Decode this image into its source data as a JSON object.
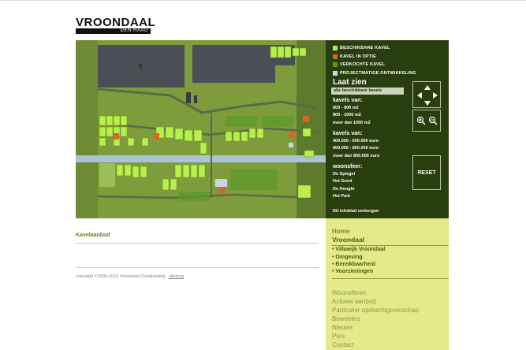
{
  "logo": {
    "main": "VROONDAAL",
    "sub": "DEN HAAG"
  },
  "legend": [
    {
      "label": "BESCHIKBARE KAVEL",
      "color": "#b8f04a"
    },
    {
      "label": "KAVEL IN OPTIE",
      "color": "#d2691e"
    },
    {
      "label": "VERKOCHTE KAVEL",
      "color": "#5a9a2a"
    },
    {
      "label": "PROJECTMATIGE ONTWIKKELING",
      "color": "#c8d6e8"
    }
  ],
  "filters": {
    "title": "Laat zien",
    "all_label": "alle beschikbare kavels",
    "kavels_van_head": "kavels van:",
    "kavels_van": [
      "600 - 800 m2",
      "800 - 1000 m2",
      "meer dan 1000 m2"
    ],
    "prijs_head": "kavels van:",
    "prijs": [
      "400.000 - 600.000 euro",
      "600.000 - 800.000 euro",
      "meer dan 800.000 euro"
    ],
    "woonsfeer_head": "woonsfeer:",
    "woonsfeer": [
      "De Spiegel",
      "Het Goed",
      "De Hoogte",
      "Het Park"
    ],
    "reset_label": "RESET",
    "infoblad": "Dit infoblad verbergen"
  },
  "content": {
    "title": "Kavelaanbod",
    "copyright": "copyright ©2009-2010 Vroondaal Ontwikkeling - ",
    "sitemap": "sitemap"
  },
  "sidenav": {
    "home": "Home",
    "current": "Vroondaal",
    "sub": [
      "• Villawijk Vroondaal",
      "• Omgeving",
      "• Bereikbaarheid",
      "• Voorzieningen"
    ],
    "main": [
      "Woonsferen",
      "Actueel aanbod",
      "Particulier opdrachtgeverschap",
      "Bewoners",
      "Nieuws",
      "Pers",
      "Contact"
    ]
  }
}
